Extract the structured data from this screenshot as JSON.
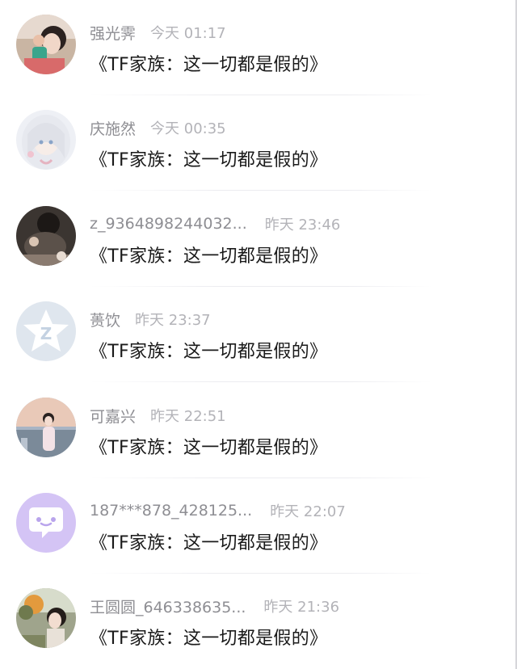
{
  "comments": [
    {
      "username": "强光霁",
      "time": "今天 01:17",
      "message": "《TF家族：这一切都是假的》",
      "avatar": "photo-avatar-1"
    },
    {
      "username": "庆施然",
      "time": "今天 00:35",
      "message": "《TF家族：这一切都是假的》",
      "avatar": "anime-avatar"
    },
    {
      "username": "z_9364898244032...",
      "time": "昨天 23:46",
      "message": "《TF家族：这一切都是假的》",
      "avatar": "dark-photo-avatar"
    },
    {
      "username": "蒉饮",
      "time": "昨天 23:37",
      "message": "《TF家族：这一切都是假的》",
      "avatar": "default-z-avatar"
    },
    {
      "username": "可嘉兴",
      "time": "昨天 22:51",
      "message": "《TF家族：这一切都是假的》",
      "avatar": "girl-photo-avatar"
    },
    {
      "username": "187***878_428125...",
      "time": "昨天 22:07",
      "message": "《TF家族：这一切都是假的》",
      "avatar": "chat-bubble-avatar"
    },
    {
      "username": "王圆圆_646338635...",
      "time": "昨天 21:36",
      "message": "《TF家族：这一切都是假的》",
      "avatar": "outdoor-photo-avatar"
    }
  ],
  "colors": {
    "username": "#8e8e93",
    "time": "#b3b3b8",
    "message": "#1a1a1a",
    "default_avatar_bg": "#dfe6ee",
    "chat_avatar_bg": "#d4c4f5"
  }
}
